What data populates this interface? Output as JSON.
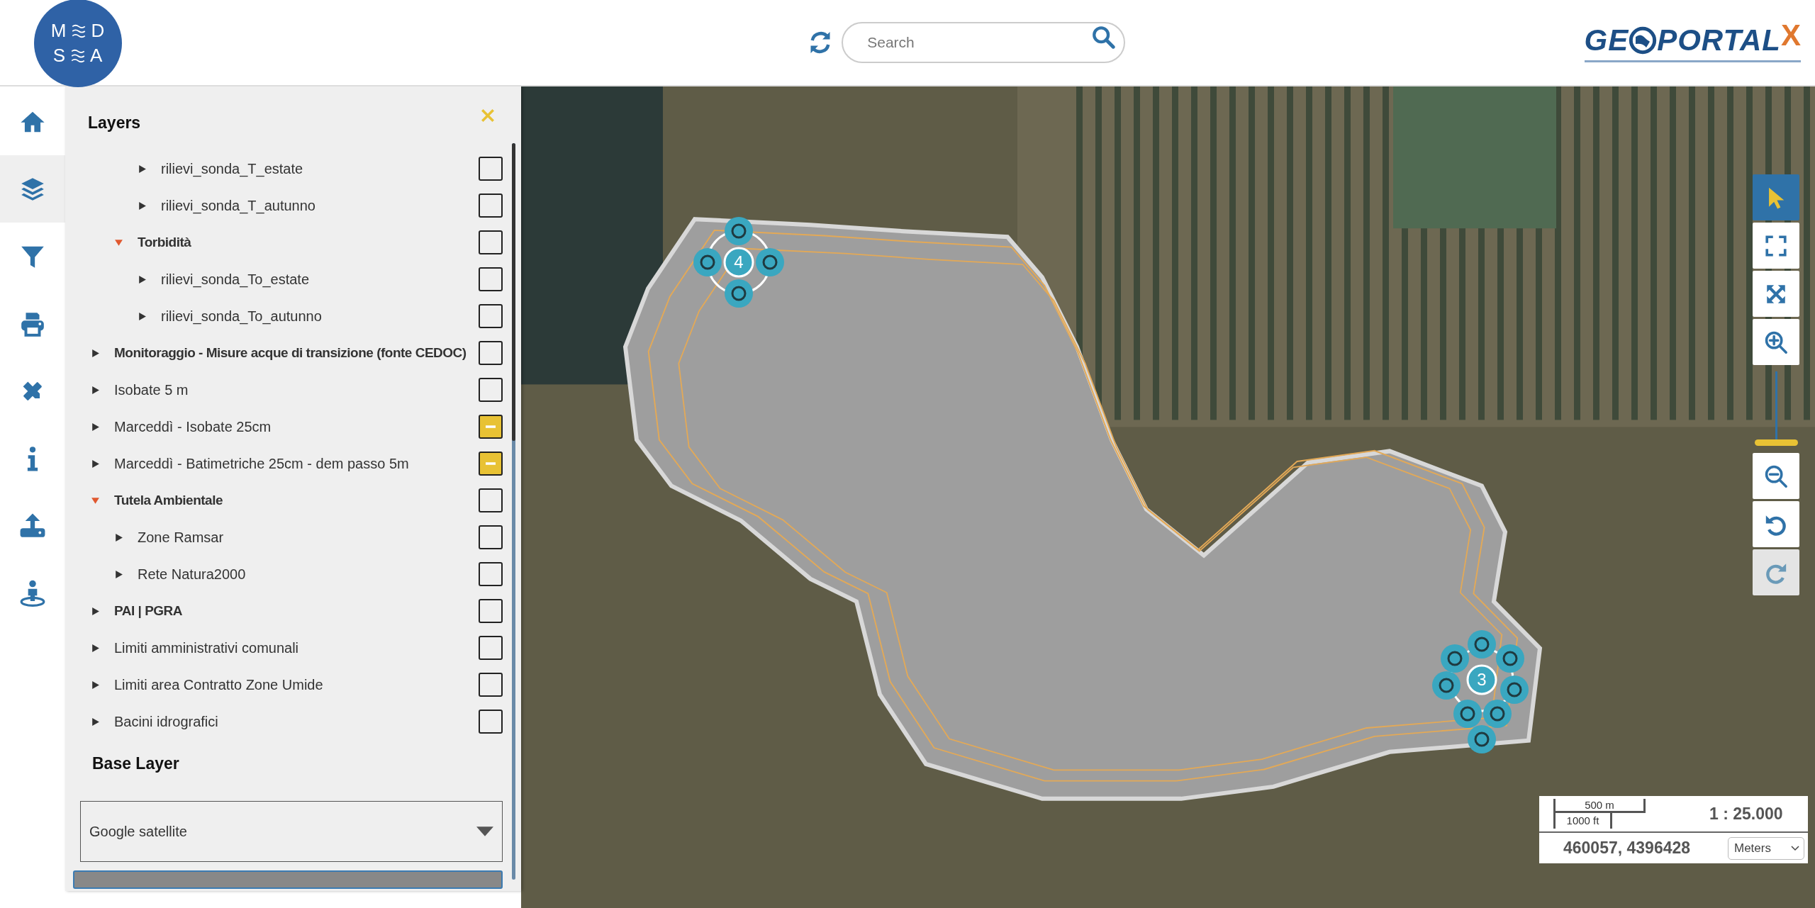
{
  "header": {
    "logo": {
      "rows": [
        {
          "left": "M",
          "right": "D"
        },
        {
          "left": "S",
          "right": "A"
        }
      ]
    },
    "search": {
      "placeholder": "Search"
    },
    "brand": {
      "prefix": "GE",
      "suffix": "PORTAL",
      "mark": "X"
    }
  },
  "sidebar": {
    "items": [
      {
        "kind": "home",
        "selected": false
      },
      {
        "kind": "layers",
        "selected": true
      },
      {
        "kind": "filter",
        "selected": false
      },
      {
        "kind": "print",
        "selected": false
      },
      {
        "kind": "tools",
        "selected": false
      },
      {
        "kind": "info",
        "selected": false
      },
      {
        "kind": "upload",
        "selected": false
      },
      {
        "kind": "person",
        "selected": false
      }
    ]
  },
  "layers_panel": {
    "title": "Layers",
    "layers": [
      {
        "children": [
          {
            "children": [
              {
                "label": "rilievi_sonda_T_estate",
                "kind": "layer",
                "expanded": false,
                "checked": false,
                "partial": false
              },
              {
                "label": "rilievi_sonda_T_autunno",
                "kind": "layer",
                "expanded": false,
                "checked": false,
                "partial": false
              }
            ]
          },
          {
            "label": "Torbidità",
            "kind": "group",
            "expanded": true,
            "checked": false,
            "partial": false,
            "children": [
              {
                "label": "rilievi_sonda_To_estate",
                "kind": "layer",
                "expanded": false,
                "checked": false,
                "partial": false
              },
              {
                "label": "rilievi_sonda_To_autunno",
                "kind": "layer",
                "expanded": false,
                "checked": false,
                "partial": false
              }
            ]
          }
        ]
      },
      {
        "label": "Monitoraggio - Misure acque di transizione (fonte CEDOC)",
        "kind": "group",
        "expanded": false,
        "checked": false,
        "partial": false
      },
      {
        "label": "Isobate 5 m",
        "kind": "layer",
        "expanded": false,
        "checked": false,
        "partial": false
      },
      {
        "label": "Marceddì - Isobate 25cm",
        "kind": "layer",
        "expanded": false,
        "checked": true,
        "partial": true
      },
      {
        "label": "Marceddì - Batimetriche 25cm - dem passo 5m",
        "kind": "layer",
        "expanded": false,
        "checked": true,
        "partial": true
      },
      {
        "label": "Tutela Ambientale",
        "kind": "group",
        "expanded": true,
        "checked": false,
        "partial": false,
        "children": [
          {
            "label": "Zone Ramsar",
            "kind": "layer",
            "expanded": false,
            "checked": false,
            "partial": false
          },
          {
            "label": "Rete Natura2000",
            "kind": "layer",
            "expanded": false,
            "checked": false,
            "partial": false
          }
        ]
      },
      {
        "label": "PAI | PGRA",
        "kind": "group",
        "expanded": false,
        "checked": false,
        "partial": false
      },
      {
        "label": "Limiti amministrativi comunali",
        "kind": "layer",
        "expanded": false,
        "checked": false,
        "partial": false
      },
      {
        "label": "Limiti area Contratto Zone Umide",
        "kind": "layer",
        "expanded": false,
        "checked": false,
        "partial": false
      },
      {
        "label": "Bacini idrografici",
        "kind": "layer",
        "expanded": false,
        "checked": false,
        "partial": false
      }
    ],
    "base_layer": {
      "title": "Base Layer",
      "select": {
        "value": "Google satellite"
      }
    }
  },
  "map": {
    "clusters": [
      {
        "count": "4",
        "kind": "cross"
      },
      {
        "count": "3",
        "kind": "ring"
      }
    ],
    "tools_top": [
      {
        "kind": "select",
        "selected": true,
        "disabled": false
      },
      {
        "kind": "fullscreen",
        "selected": false,
        "disabled": false
      },
      {
        "kind": "extent",
        "selected": false,
        "disabled": false
      },
      {
        "kind": "zoom_in",
        "selected": false,
        "disabled": false
      }
    ],
    "zoom_slider": {
      "level": 0
    },
    "tools_bottom": [
      {
        "kind": "zoom_out",
        "selected": false,
        "disabled": false
      },
      {
        "kind": "undo",
        "selected": false,
        "disabled": false
      },
      {
        "kind": "redo",
        "selected": false,
        "disabled": true
      }
    ],
    "scale": {
      "metric": "500 m",
      "imperial": "1000 ft",
      "ratio": "1 : 25.000",
      "coordinates": "460057, 4396428",
      "units": {
        "value": "Meters"
      }
    }
  }
}
